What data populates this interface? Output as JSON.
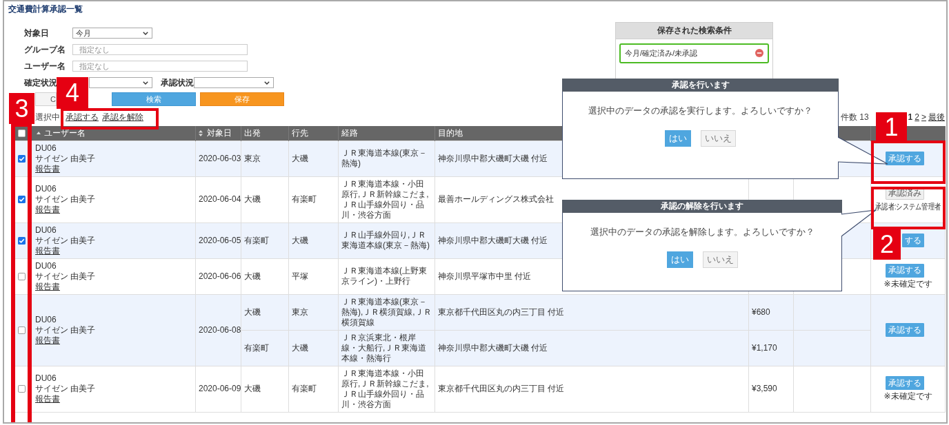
{
  "page": {
    "title": "交通費計算承認一覧"
  },
  "filters": [
    {
      "fields": [
        {
          "kind": "select",
          "label": "対象日",
          "value": "今月"
        }
      ]
    },
    {
      "fields": [
        {
          "kind": "text",
          "label": "グループ名",
          "placeholder": "指定なし"
        }
      ]
    },
    {
      "fields": [
        {
          "kind": "text",
          "label": "ユーザー名",
          "placeholder": "指定なし"
        }
      ]
    },
    {
      "fields": [
        {
          "kind": "select",
          "label": "確定状況"
        },
        {
          "kind": "select",
          "label": "承認状況"
        }
      ]
    }
  ],
  "filter_buttons": [
    {
      "kind": "clear",
      "label": "C"
    },
    {
      "kind": "search",
      "label": "検索"
    },
    {
      "kind": "save",
      "label": "保存"
    }
  ],
  "saved_searches": {
    "title": "保存された検索条件",
    "items": [
      {
        "label": "今月/確定済み/未承認"
      }
    ]
  },
  "selection_bar": {
    "label": "選択中",
    "actions": [
      "承認する",
      "承認を解除"
    ]
  },
  "pagination": {
    "count": "件数 13",
    "pages": [
      {
        "label": "1",
        "selected": true
      },
      {
        "label": "2",
        "selected": false
      }
    ],
    "next": ">",
    "last": "最後"
  },
  "table": {
    "select_all": {
      "checked": false
    },
    "columns": [
      {
        "label": "ユーザー名",
        "sortable": true,
        "sorted": true
      },
      {
        "label": "対象日",
        "sortable": true,
        "sorted": false
      },
      {
        "label": "出発",
        "sortable": false
      },
      {
        "label": "行先",
        "sortable": false
      },
      {
        "label": "経路",
        "sortable": false
      },
      {
        "label": "目的地",
        "sortable": false
      }
    ],
    "rows": [
      {
        "checked": true,
        "user_id": "DU06",
        "user_name": "サイゼン 由美子",
        "report": "報告書",
        "date": "2020-06-03",
        "trips": [
          {
            "from": "東京",
            "to": "大磯",
            "route": "ＪＲ東海道本線(東京－熱海)",
            "destination": "神奈川県中郡大磯町大磯 付近"
          }
        ],
        "action": {
          "kind": "approve",
          "label": "承認する"
        }
      },
      {
        "checked": true,
        "user_id": "DU06",
        "user_name": "サイゼン 由美子",
        "report": "報告書",
        "date": "2020-06-04",
        "trips": [
          {
            "from": "大磯",
            "to": "有楽町",
            "route": "ＪＲ東海道本線・小田原行,ＪＲ新幹線こだま,ＪＲ山手線外回り・品川・渋谷方面",
            "destination": "最善ホールディングス株式会社"
          }
        ],
        "action": {
          "kind": "approved",
          "label": "承認済み",
          "approver": "承認者:システム管理者"
        }
      },
      {
        "checked": true,
        "user_id": "DU06",
        "user_name": "サイゼン 由美子",
        "report": "報告書",
        "date": "2020-06-05",
        "trips": [
          {
            "from": "有楽町",
            "to": "大磯",
            "route": "ＪＲ山手線外回り,ＪＲ東海道本線(東京－熱海)",
            "destination": "神奈川県中郡大磯町大磯 付近"
          }
        ],
        "action": {
          "kind": "approve",
          "label": "する"
        }
      },
      {
        "checked": false,
        "user_id": "DU06",
        "user_name": "サイゼン 由美子",
        "report": "報告書",
        "date": "2020-06-06",
        "trips": [
          {
            "from": "大磯",
            "to": "平塚",
            "route": "ＪＲ東海道本線(上野東京ライン)・上野行",
            "destination": "神奈川県平塚市中里 付近"
          }
        ],
        "action": {
          "kind": "approve",
          "label": "承認する",
          "note": "※未確定です"
        }
      },
      {
        "checked": false,
        "user_id": "DU06",
        "user_name": "サイゼン 由美子",
        "report": "報告書",
        "date": "2020-06-08",
        "trips": [
          {
            "from": "大磯",
            "to": "東京",
            "route": "ＪＲ東海道本線(東京－熱海),ＪＲ横須賀線,ＪＲ横須賀線",
            "destination": "東京都千代田区丸の内三丁目 付近",
            "amount": "¥680"
          },
          {
            "from": "有楽町",
            "to": "大磯",
            "route": "ＪＲ京浜東北・根岸線・大船行,ＪＲ東海道本線・熱海行",
            "destination": "神奈川県中郡大磯町大磯 付近",
            "amount": "¥1,170"
          }
        ],
        "action": {
          "kind": "approve",
          "label": "承認する"
        }
      },
      {
        "checked": false,
        "user_id": "DU06",
        "user_name": "サイゼン 由美子",
        "report": "報告書",
        "date": "2020-06-09",
        "trips": [
          {
            "from": "大磯",
            "to": "有楽町",
            "route": "ＪＲ東海道本線・小田原行,ＪＲ新幹線こだま,ＪＲ山手線外回り・品川・渋谷方面",
            "destination": "東京都千代田区丸の内三丁目 付近",
            "amount": "¥3,590"
          }
        ],
        "action": {
          "kind": "approve",
          "label": "承認する",
          "note": "※未確定です"
        }
      }
    ]
  },
  "dialogs": [
    {
      "title": "承認を行います",
      "message": "選択中のデータの承認を実行します。よろしいですか？",
      "buttons": [
        {
          "kind": "primary",
          "label": "はい"
        },
        {
          "kind": "secondary",
          "label": "いいえ"
        }
      ]
    },
    {
      "title": "承認の解除を行います",
      "message": "選択中のデータの承認を解除します。よろしいですか？",
      "buttons": [
        {
          "kind": "primary",
          "label": "はい"
        },
        {
          "kind": "secondary",
          "label": "いいえ"
        }
      ]
    }
  ],
  "annotations": [
    {
      "number": "1"
    },
    {
      "number": "2"
    },
    {
      "number": "3"
    },
    {
      "number": "4"
    }
  ]
}
